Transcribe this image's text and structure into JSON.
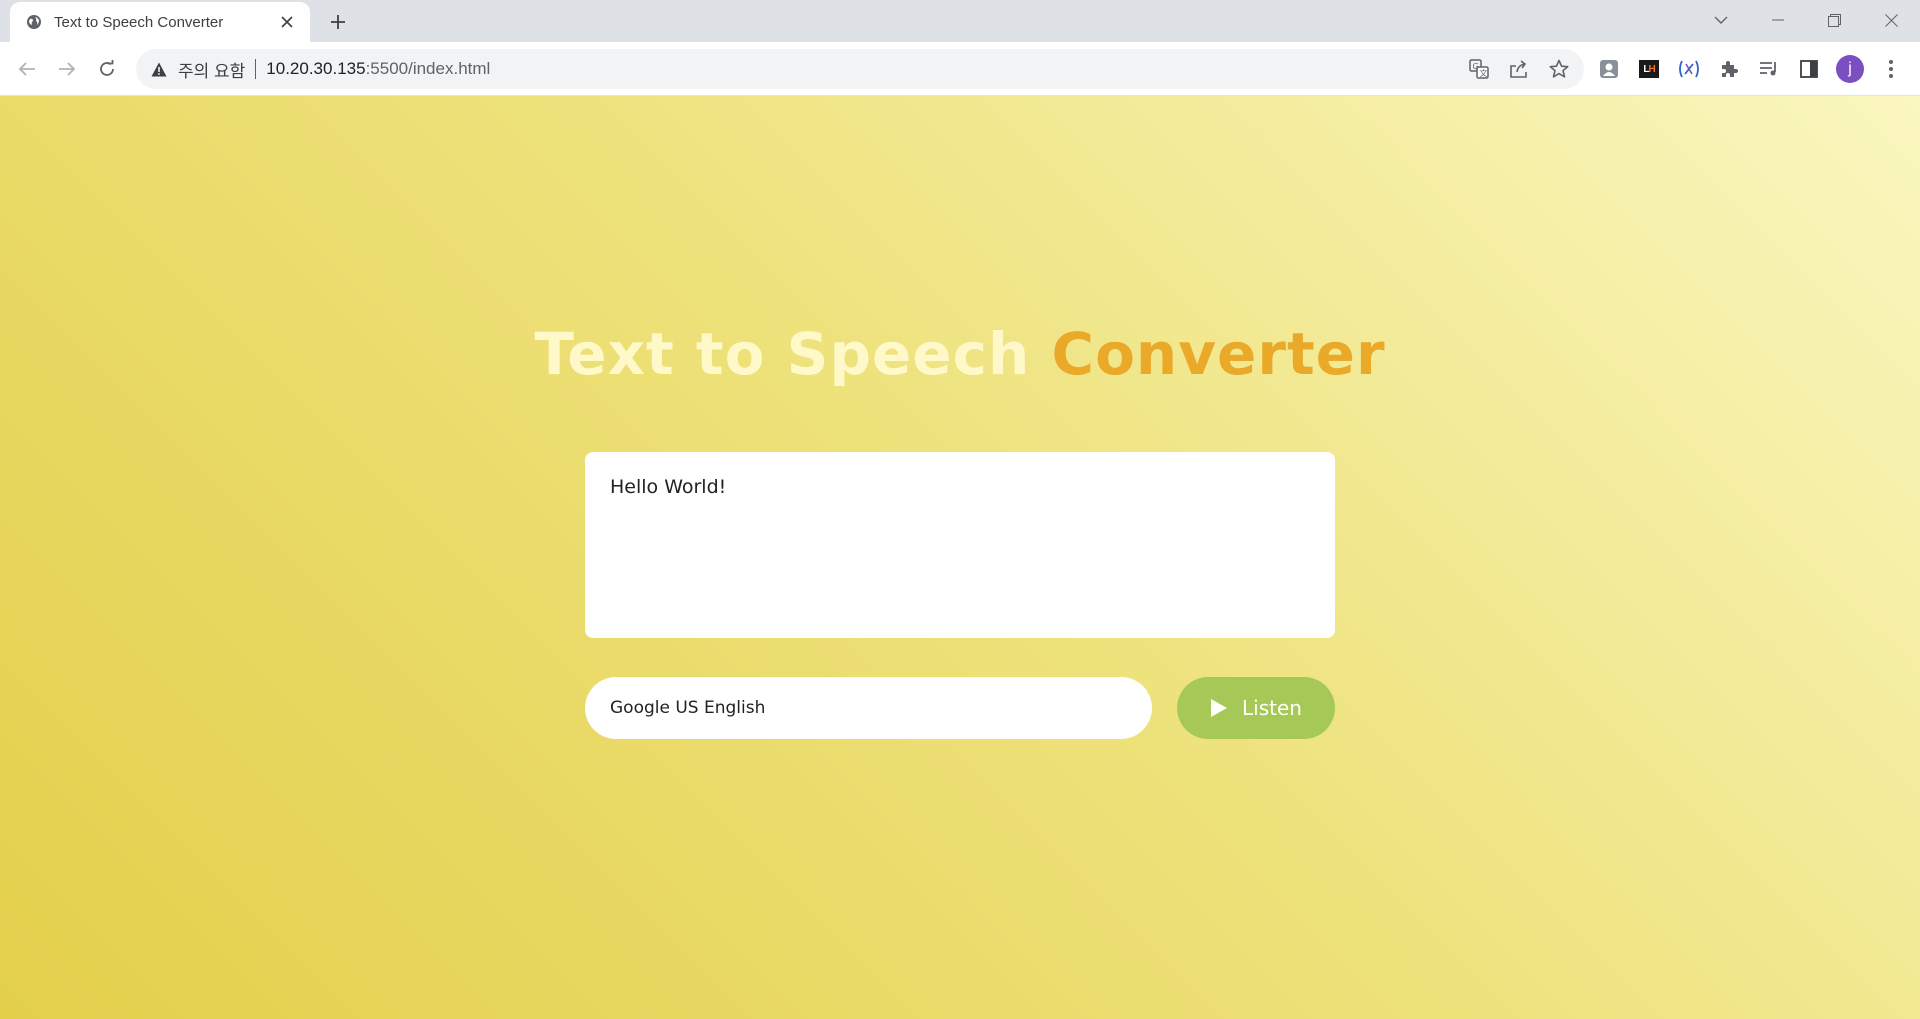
{
  "browser": {
    "tab": {
      "title": "Text to Speech Converter",
      "favicon": "globe-icon"
    },
    "omnibox": {
      "security_text": "주의 요함",
      "url_host": "10.20.30.135",
      "url_rest": ":5500/index.html"
    },
    "profile_initial": "j",
    "extensions": {
      "lighthouse_label_l": "L",
      "lighthouse_label_h": "H"
    }
  },
  "page": {
    "heading_main": "Text to Speech ",
    "heading_accent": "Converter",
    "textarea_value": "Hello World!",
    "voice_selected": "Google US English",
    "listen_label": "Listen"
  },
  "colors": {
    "background_start": "#e3cf4a",
    "background_end": "#faf7c0",
    "heading_main": "#fff8c8",
    "heading_accent": "#eba92a",
    "listen_button": "#a6c857"
  }
}
